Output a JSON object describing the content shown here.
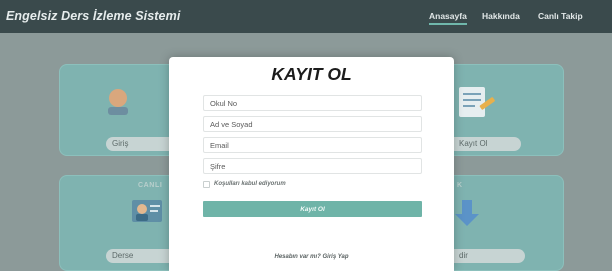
{
  "navbar": {
    "brand": "Engelsiz Ders İzleme Sistemi",
    "links": [
      {
        "label": "Anasayfa",
        "active": true
      },
      {
        "label": "Hakkında",
        "active": false
      },
      {
        "label": "Canlı Takip",
        "active": false
      }
    ]
  },
  "background": {
    "tiles": [
      {
        "label": "Giriş",
        "icon": "login-icon"
      },
      {
        "label": "Kayıt Ol",
        "icon": "register-form-icon"
      },
      {
        "caption": "CANLI",
        "label": "Derse",
        "icon": "live-lesson-icon"
      },
      {
        "caption": "K",
        "label": "dir",
        "icon": "download-arrow-icon"
      }
    ]
  },
  "modal": {
    "title": "KAYIT OL",
    "fields": {
      "okul_no": {
        "placeholder": "Okul No",
        "value": ""
      },
      "ad_soyad": {
        "placeholder": "Ad ve Soyad",
        "value": ""
      },
      "email": {
        "placeholder": "Email",
        "value": ""
      },
      "sifre": {
        "placeholder": "Şifre",
        "value": ""
      }
    },
    "terms_label": "Koşulları kabul ediyorum",
    "terms_checked": false,
    "submit_label": "Kayıt Ol",
    "login_link": "Hesabın var mı? Giriş Yap"
  },
  "colors": {
    "navbar_bg": "#3a4a4c",
    "accent": "#6fb4a8",
    "overlay": "#8c9a99"
  }
}
